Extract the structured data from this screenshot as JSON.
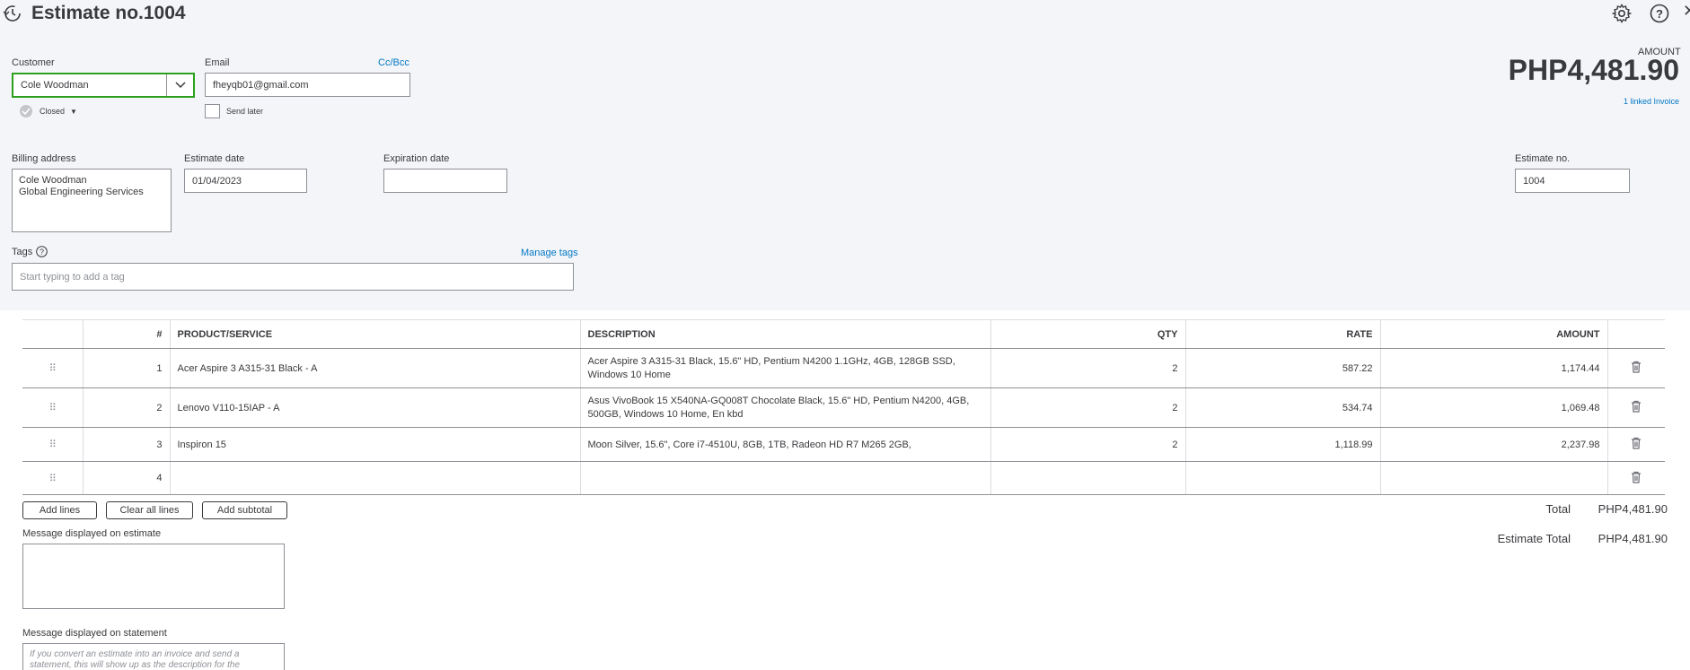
{
  "header": {
    "title": "Estimate no.1004"
  },
  "customer": {
    "label": "Customer",
    "value": "Cole Woodman",
    "status": "Closed"
  },
  "email": {
    "label": "Email",
    "value": "fheyqb01@gmail.com",
    "cc_bcc": "Cc/Bcc",
    "send_later": "Send later"
  },
  "amount": {
    "label": "AMOUNT",
    "value": "PHP4,481.90",
    "linked": "1 linked Invoice"
  },
  "billing": {
    "label": "Billing address",
    "line1": "Cole Woodman",
    "line2": "Global Engineering Services"
  },
  "estimate_date": {
    "label": "Estimate date",
    "value": "01/04/2023"
  },
  "expiration_date": {
    "label": "Expiration date",
    "value": ""
  },
  "estimate_no": {
    "label": "Estimate no.",
    "value": "1004"
  },
  "tags": {
    "label": "Tags",
    "manage": "Manage tags",
    "placeholder": "Start typing to add a tag"
  },
  "table": {
    "headers": [
      "#",
      "PRODUCT/SERVICE",
      "DESCRIPTION",
      "QTY",
      "RATE",
      "AMOUNT"
    ],
    "rows": [
      {
        "num": "1",
        "product": "Acer Aspire 3 A315-31 Black - A",
        "desc1": "Acer Aspire 3 A315-31 Black, 15.6\" HD, Pentium N4200 1.1GHz, 4GB, 128GB SSD,",
        "desc2": "Windows 10 Home",
        "qty": "2",
        "rate": "587.22",
        "amount": "1,174.44"
      },
      {
        "num": "2",
        "product": "Lenovo V110-15IAP - A",
        "desc1": "Asus VivoBook 15 X540NA-GQ008T Chocolate Black, 15.6\" HD, Pentium N4200, 4GB,",
        "desc2": "500GB, Windows 10 Home, En kbd",
        "qty": "2",
        "rate": "534.74",
        "amount": "1,069.48"
      },
      {
        "num": "3",
        "product": "Inspiron 15",
        "desc1": "Moon Silver, 15.6\", Core i7-4510U, 8GB, 1TB, Radeon HD R7 M265 2GB,",
        "desc2": "",
        "qty": "2",
        "rate": "1,118.99",
        "amount": "2,237.98"
      },
      {
        "num": "4",
        "product": "",
        "desc1": "",
        "desc2": "",
        "qty": "",
        "rate": "",
        "amount": ""
      }
    ]
  },
  "buttons": {
    "add_lines": "Add lines",
    "clear_all": "Clear all lines",
    "add_subtotal": "Add subtotal"
  },
  "totals": {
    "total_label": "Total",
    "total_value": "PHP4,481.90",
    "estimate_total_label": "Estimate Total",
    "estimate_total_value": "PHP4,481.90"
  },
  "messages": {
    "estimate_label": "Message displayed on estimate",
    "statement_label": "Message displayed on statement",
    "statement_placeholder": "If you convert an estimate into an invoice and send a statement, this will show up as the description for the"
  }
}
